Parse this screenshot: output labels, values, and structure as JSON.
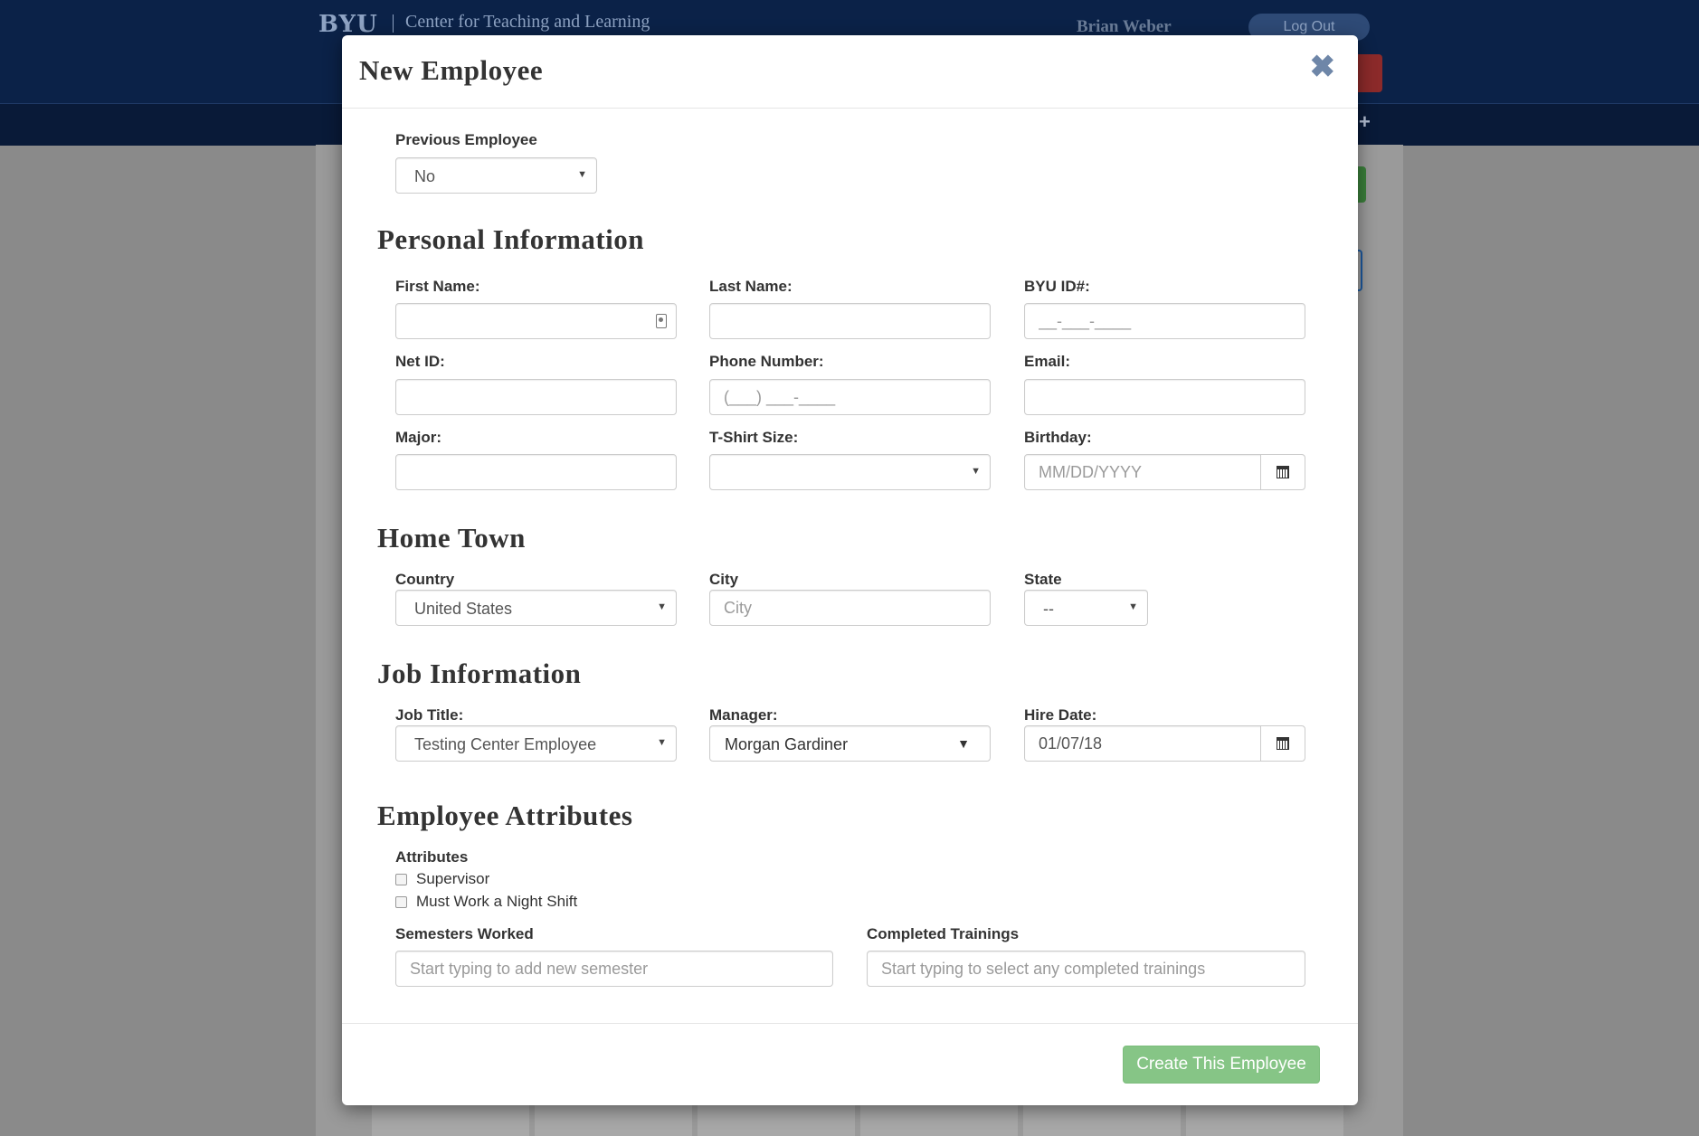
{
  "background": {
    "logo": "BYU",
    "site_name": "Center for Teaching and Learning",
    "user_name": "Brian Weber",
    "logout_label": "Log Out",
    "plus": "+"
  },
  "modal": {
    "title": "New Employee",
    "close_glyph": "✖",
    "previous_employee": {
      "label": "Previous Employee",
      "value": "No"
    },
    "sections": {
      "personal": "Personal Information",
      "hometown": "Home Town",
      "job": "Job Information",
      "attributes": "Employee Attributes"
    },
    "personal": {
      "first_name": {
        "label": "First Name:",
        "placeholder": "",
        "value": ""
      },
      "last_name": {
        "label": "Last Name:",
        "placeholder": "",
        "value": ""
      },
      "byu_id": {
        "label": "BYU ID#:",
        "placeholder": "__-___-____",
        "value": ""
      },
      "net_id": {
        "label": "Net ID:",
        "placeholder": "",
        "value": ""
      },
      "phone": {
        "label": "Phone Number:",
        "placeholder": "(___) ___-____",
        "value": ""
      },
      "email": {
        "label": "Email:",
        "placeholder": "",
        "value": ""
      },
      "major": {
        "label": "Major:",
        "placeholder": "",
        "value": ""
      },
      "tshirt": {
        "label": "T-Shirt Size:",
        "value": ""
      },
      "birthday": {
        "label": "Birthday:",
        "placeholder": "MM/DD/YYYY",
        "value": ""
      }
    },
    "hometown": {
      "country": {
        "label": "Country",
        "value": "United States"
      },
      "city": {
        "label": "City",
        "placeholder": "City",
        "value": ""
      },
      "state": {
        "label": "State",
        "value": "--"
      }
    },
    "job": {
      "title": {
        "label": "Job Title:",
        "value": "Testing Center Employee"
      },
      "manager": {
        "label": "Manager:",
        "value": "Morgan Gardiner"
      },
      "hire_date": {
        "label": "Hire Date:",
        "placeholder": "",
        "value": "01/07/18"
      }
    },
    "attributes": {
      "label": "Attributes",
      "options": [
        {
          "label": "Supervisor",
          "checked": false
        },
        {
          "label": "Must Work a Night Shift",
          "checked": false
        }
      ],
      "semesters": {
        "label": "Semesters Worked",
        "placeholder": "Start typing to add new semester"
      },
      "trainings": {
        "label": "Completed Trainings",
        "placeholder": "Start typing to select any completed trainings"
      }
    },
    "create_button": "Create This Employee"
  }
}
